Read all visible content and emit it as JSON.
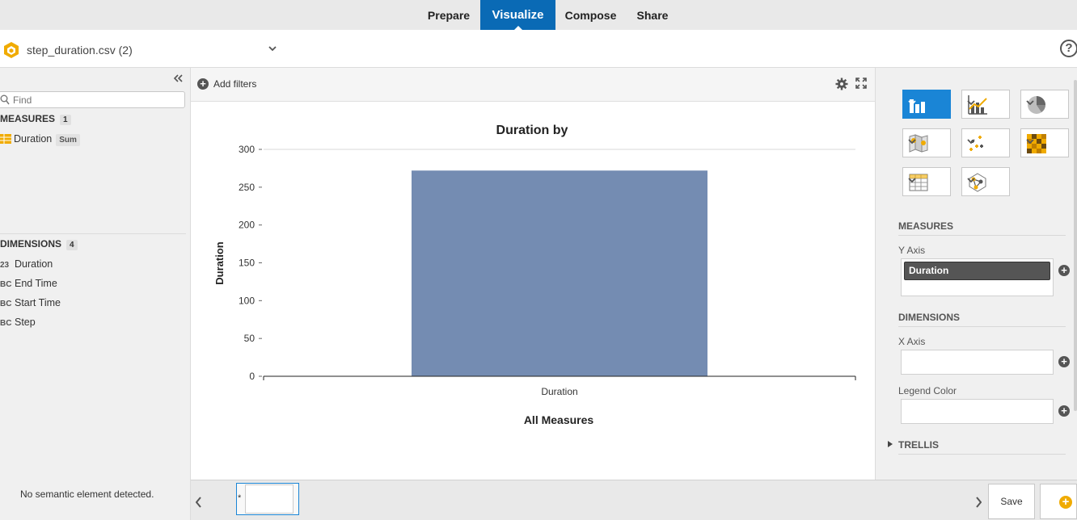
{
  "nav": {
    "tabs": [
      {
        "label": "Prepare",
        "active": false
      },
      {
        "label": "Visualize",
        "active": true
      },
      {
        "label": "Compose",
        "active": false
      },
      {
        "label": "Share",
        "active": false
      }
    ]
  },
  "doc": {
    "title": "step_duration.csv (2)",
    "help_icon": "?"
  },
  "left": {
    "find_placeholder": "Find",
    "measures_title": "MEASURES",
    "measures_count": "1",
    "measures": [
      {
        "type_icon": "measure-icon",
        "label": "Duration",
        "agg": "Sum"
      }
    ],
    "dimensions_title": "DIMENSIONS",
    "dimensions_count": "4",
    "dimensions": [
      {
        "type": "23",
        "label": "Duration"
      },
      {
        "type": "BC",
        "label": "End Time"
      },
      {
        "type": "BC",
        "label": "Start Time"
      },
      {
        "type": "BC",
        "label": "Step"
      }
    ],
    "status": "No semantic element detected."
  },
  "filters": {
    "add_label": "Add filters"
  },
  "chart_data": {
    "type": "bar",
    "title": "Duration by",
    "xlabel": "All Measures",
    "ylabel": "Duration",
    "categories": [
      "Duration"
    ],
    "values": [
      272
    ],
    "ylim": [
      0,
      300
    ],
    "yticks": [
      0,
      50,
      100,
      150,
      200,
      250,
      300
    ],
    "ytick_labels": [
      "0",
      "50",
      "100",
      "150",
      "200",
      "250",
      "300"
    ],
    "bar_color": "#748cb2",
    "grid": false,
    "legend": false
  },
  "right": {
    "measures_title": "MEASURES",
    "y_axis_label": "Y Axis",
    "y_axis_value": "Duration",
    "dimensions_title": "DIMENSIONS",
    "x_axis_label": "X Axis",
    "legend_label": "Legend Color",
    "trellis_title": "TRELLIS",
    "chart_types": [
      "bar-chart-icon",
      "combo-chart-icon",
      "pie-chart-icon",
      "geo-map-icon",
      "scatter-plot-icon",
      "heatmap-icon",
      "table-icon",
      "network-icon"
    ]
  },
  "bottom": {
    "page_marker": "*",
    "save_label": "Save",
    "accent": "#0a6ab5",
    "icon_orange": "#f0ab00"
  }
}
